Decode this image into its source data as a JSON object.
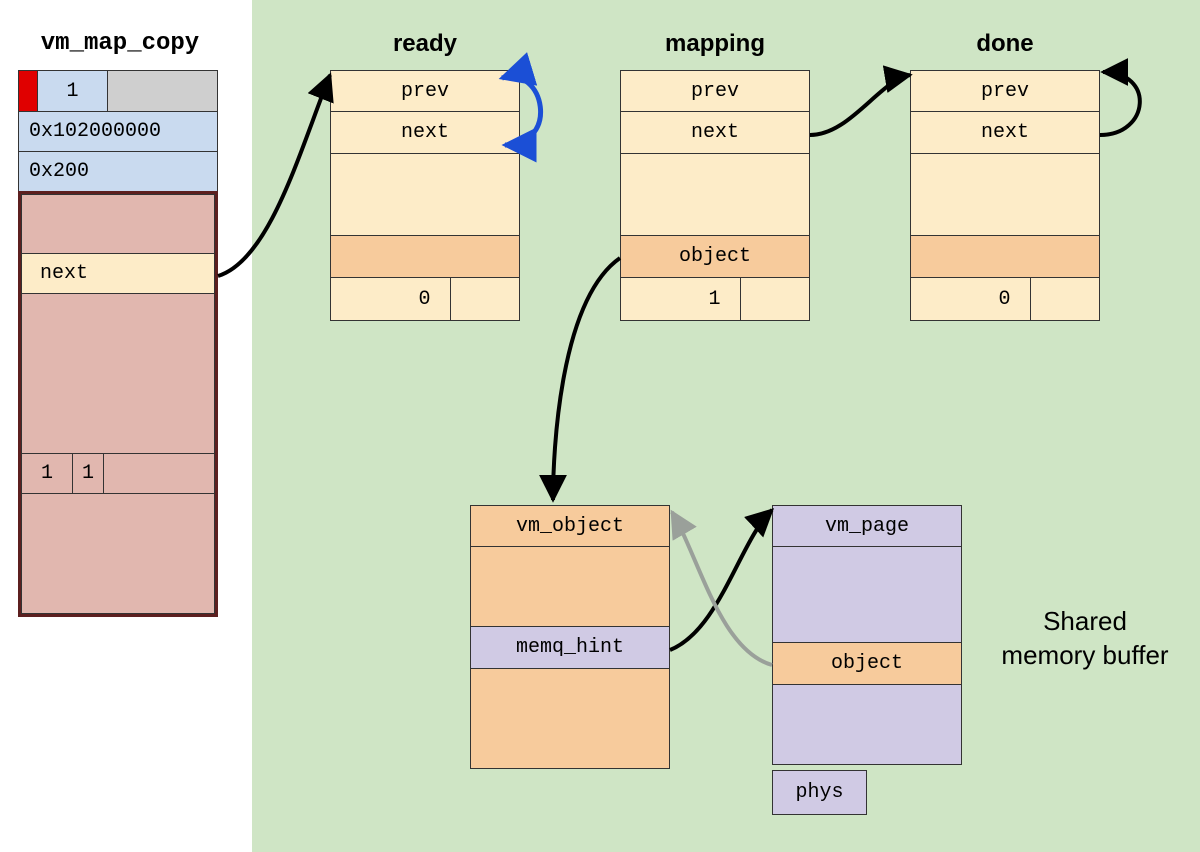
{
  "titles": {
    "vm_map_copy": "vm_map_copy",
    "ready": "ready",
    "mapping": "mapping",
    "done": "done"
  },
  "vm_map_copy": {
    "flag": "1",
    "address": "0x102000000",
    "size": "0x200",
    "entry": {
      "next": "next",
      "flag1": "1",
      "flag2": "1"
    }
  },
  "entries": {
    "ready": {
      "prev": "prev",
      "next": "next",
      "object": "",
      "flag": "0"
    },
    "mapping": {
      "prev": "prev",
      "next": "next",
      "object": "object",
      "flag": "1"
    },
    "done": {
      "prev": "prev",
      "next": "next",
      "object": "",
      "flag": "0"
    }
  },
  "vm_object": {
    "title": "vm_object",
    "memq_hint": "memq_hint"
  },
  "vm_page": {
    "title": "vm_page",
    "object": "object",
    "phys": "phys"
  },
  "shared_label": "Shared memory buffer",
  "colors": {
    "green_bg": "#cfe5c5",
    "cream": "#fdecc8",
    "orange": "#f7cb9c",
    "purple": "#d0cae4",
    "blue": "#c9daef",
    "pink": "#e1b7af",
    "red": "#e00000",
    "grey": "#cfcfcf",
    "dkred": "#5c1f1f",
    "arrow_blue": "#1b4fd6"
  }
}
